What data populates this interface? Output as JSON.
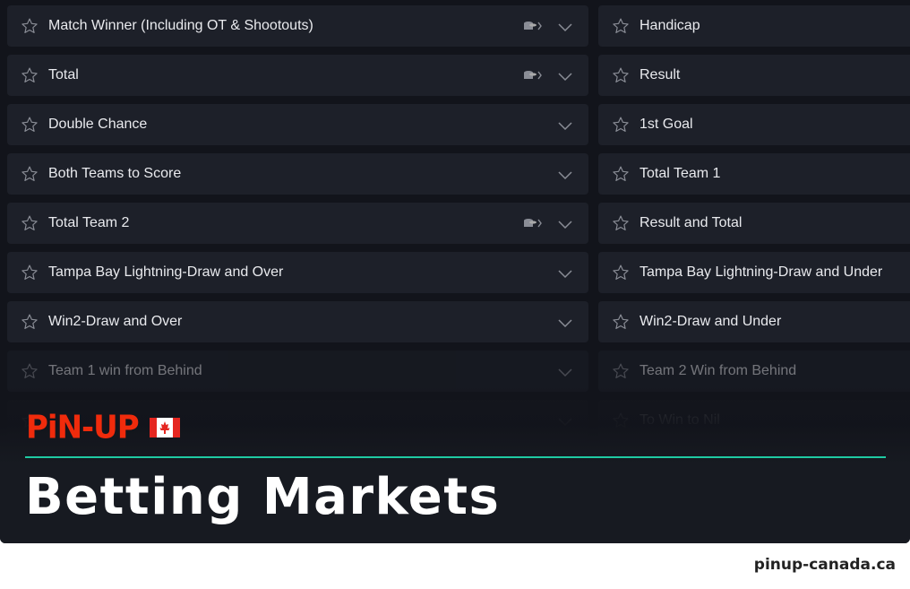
{
  "markets_left": [
    {
      "label": "Match Winner (Including OT & Shootouts)",
      "has_coins": true
    },
    {
      "label": "Total",
      "has_coins": true
    },
    {
      "label": "Double Chance",
      "has_coins": false
    },
    {
      "label": "Both Teams to Score",
      "has_coins": false
    },
    {
      "label": "Total Team 2",
      "has_coins": true
    },
    {
      "label": "Tampa Bay Lightning-Draw and Over",
      "has_coins": false
    },
    {
      "label": "Win2-Draw and Over",
      "has_coins": false
    },
    {
      "label": "Team 1 win from Behind",
      "has_coins": false
    },
    {
      "label": "",
      "has_coins": false
    }
  ],
  "markets_right": [
    {
      "label": "Handicap"
    },
    {
      "label": "Result"
    },
    {
      "label": "1st Goal"
    },
    {
      "label": "Total Team 1"
    },
    {
      "label": "Result and Total"
    },
    {
      "label": "Tampa Bay Lightning-Draw and Under"
    },
    {
      "label": "Win2-Draw and Under"
    },
    {
      "label": "Team 2 Win from Behind"
    },
    {
      "label": "To Win to Nil"
    }
  ],
  "brand": {
    "logo_text": "PiN-UP",
    "flag": "canada-flag",
    "accent": "#1fcaa3",
    "logo_color": "#f02b0c"
  },
  "title": "Betting Markets",
  "footer": "pinup-canada.ca"
}
